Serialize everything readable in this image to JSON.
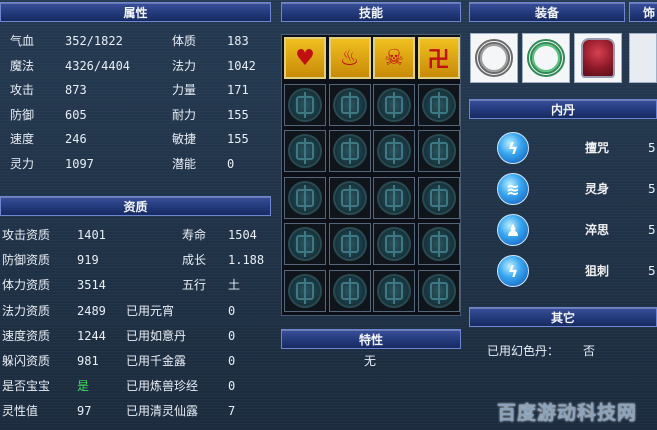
{
  "attributes": {
    "header": "属性",
    "rows": [
      {
        "l1": "气血",
        "v1": "352/1822",
        "l2": "体质",
        "v2": "183"
      },
      {
        "l1": "魔法",
        "v1": "4326/4404",
        "l2": "法力",
        "v2": "1042"
      },
      {
        "l1": "攻击",
        "v1": "873",
        "l2": "力量",
        "v2": "171"
      },
      {
        "l1": "防御",
        "v1": "605",
        "l2": "耐力",
        "v2": "155"
      },
      {
        "l1": "速度",
        "v1": "246",
        "l2": "敏捷",
        "v2": "155"
      },
      {
        "l1": "灵力",
        "v1": "1097",
        "l2": "潜能",
        "v2": "0"
      }
    ]
  },
  "aptitude": {
    "header": "资质",
    "rows": [
      {
        "l1": "攻击资质",
        "v1": "1401",
        "l2": "寿命",
        "v2": "1504"
      },
      {
        "l1": "防御资质",
        "v1": "919",
        "l2": "成长",
        "v2": "1.188"
      },
      {
        "l1": "体力资质",
        "v1": "3514",
        "l2": "五行",
        "v2": "土"
      },
      {
        "l1": "法力资质",
        "v1": "2489",
        "l2": "已用元宵",
        "v2": "0"
      },
      {
        "l1": "速度资质",
        "v1": "1244",
        "l2": "已用如意丹",
        "v2": "0"
      },
      {
        "l1": "躲闪资质",
        "v1": "981",
        "l2": "已用千金露",
        "v2": "0"
      },
      {
        "l1": "是否宝宝",
        "v1": "是",
        "l2": "已用炼兽珍经",
        "v2": "0"
      },
      {
        "l1": "灵性值",
        "v1": "97",
        "l2": "已用清灵仙露",
        "v2": "7"
      }
    ]
  },
  "skills": {
    "header": "技能",
    "filled_icons": [
      "heart-skill-icon",
      "flame-skill-icon",
      "skeleton-skill-icon",
      "rune-skill-icon"
    ],
    "filled_glyphs": [
      "♥",
      "♨",
      "☠",
      "卍"
    ]
  },
  "traits": {
    "header": "特性",
    "value": "无"
  },
  "equipment": {
    "header": "装备",
    "header2": "饰"
  },
  "inner_dan": {
    "header": "内丹",
    "items": [
      {
        "name": "擅咒",
        "level": "5"
      },
      {
        "name": "灵身",
        "level": "5"
      },
      {
        "name": "淬思",
        "level": "5"
      },
      {
        "name": "狙刺",
        "level": "5"
      }
    ]
  },
  "other": {
    "header": "其它",
    "label": "已用幻色丹：",
    "value": "否"
  },
  "watermark": "百度游动科技网"
}
